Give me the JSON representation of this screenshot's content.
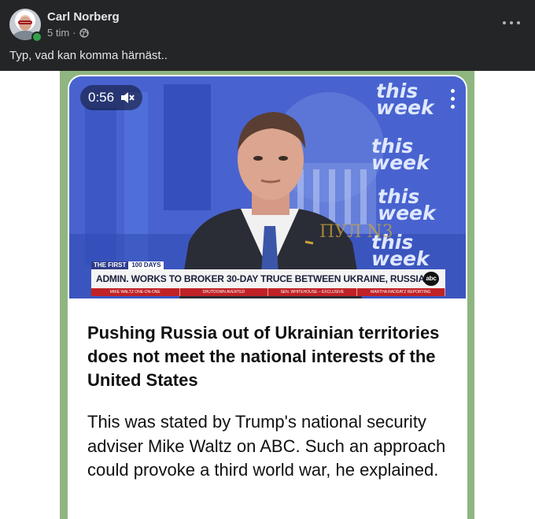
{
  "post": {
    "author": "Carl Norberg",
    "time": "5 tim",
    "separator": "·",
    "caption": "Typ, vad kan komma härnäst.."
  },
  "video": {
    "timestamp": "0:56",
    "brand_lines": [
      "this",
      "week"
    ],
    "watermark": "ПУЛ N3",
    "badge_a": "THE FIRST",
    "badge_b": "100 DAYS",
    "headline": "ADMIN. WORKS TO BROKER 30-DAY TRUCE BETWEEN UKRAINE, RUSSIA",
    "network_logo": "abc",
    "ticker": [
      "MIKE WALTZ ONE-ON-ONE",
      "SHUTDOWN AVERTED",
      "SEN. WHITEHOUSE – EXCLUSIVE",
      "MARTHA RADDATZ REPORTING"
    ]
  },
  "article": {
    "title": "Pushing Russia out of Ukrainian territories does not meet the national interests of the United States",
    "body": "This was stated by Trump's national security adviser Mike Waltz on ABC. Such an approach could provoke a third world war, he explained."
  },
  "icons": [
    "globe-icon",
    "more-horizontal-icon",
    "mute-icon",
    "more-vertical-icon"
  ],
  "colors": {
    "header_bg": "#242526",
    "online": "#31a24c",
    "media_border": "#8fb580",
    "ticker_red": "#c02226"
  }
}
